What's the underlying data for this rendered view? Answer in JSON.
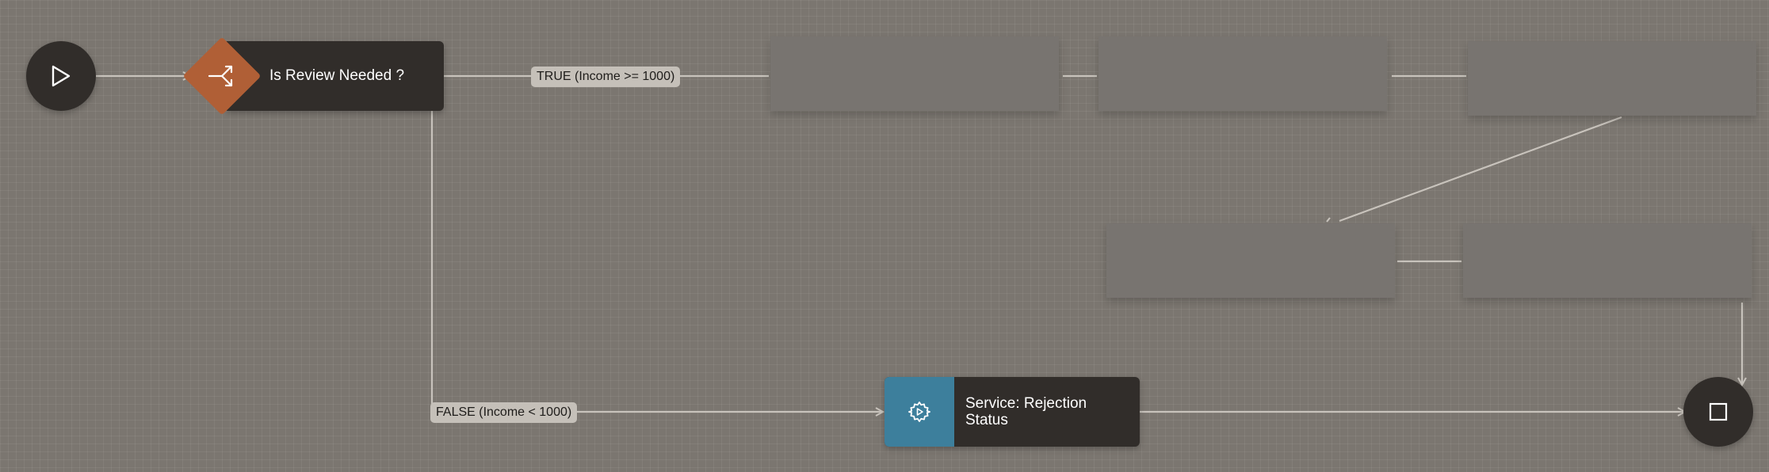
{
  "flow": {
    "gateway": {
      "label": "Is Review Needed ?",
      "icon": "branch-icon",
      "color": "#b05f36"
    },
    "service": {
      "label": "Service: Rejection Status",
      "icon": "gear-icon",
      "color": "#3d7f9c"
    },
    "start_event": {
      "icon": "play-icon"
    },
    "end_event": {
      "icon": "stop-square-icon"
    },
    "edges": {
      "true_label": "TRUE (Income >= 1000)",
      "false_label": "FALSE (Income < 1000)"
    }
  },
  "colors": {
    "canvas_background": "#7b7670",
    "node_dark": "#312d2a",
    "edge_line": "#c8c3bc",
    "edge_label_background": "#c5c0b9"
  }
}
